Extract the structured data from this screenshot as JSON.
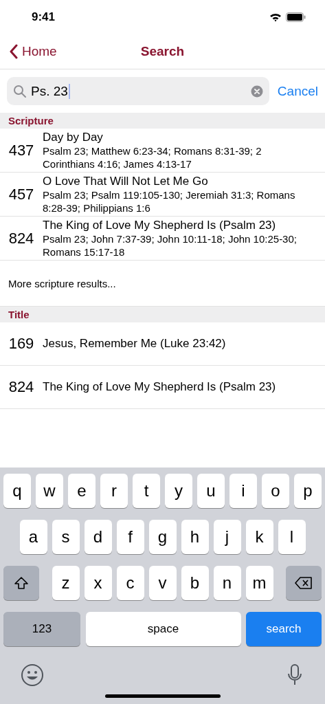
{
  "status_bar": {
    "time": "9:41"
  },
  "nav": {
    "back": "Home",
    "title": "Search"
  },
  "search": {
    "value": "Ps. 23",
    "cancel": "Cancel"
  },
  "sections": [
    {
      "title": "Scripture",
      "rows": [
        {
          "number": "437",
          "title": "Day by Day",
          "refs": "Psalm 23; Matthew 6:23-34; Romans 8:31-39; 2 Corinthians 4:16; James 4:13-17"
        },
        {
          "number": "457",
          "title": "O Love That Will Not Let Me Go",
          "refs": "Psalm 23; Psalm 119:105-130; Jeremiah 31:3; Romans 8:28-39; Philippians 1:6"
        },
        {
          "number": "824",
          "title": "The King of Love My Shepherd Is (Psalm 23)",
          "refs": "Psalm 23; John 7:37-39; John 10:11-18; John 10:25-30; Romans 15:17-18"
        }
      ],
      "more": "More scripture results..."
    },
    {
      "title": "Title",
      "rows": [
        {
          "number": "169",
          "title": "Jesus, Remember Me (Luke 23:42)"
        },
        {
          "number": "824",
          "title": "The King of Love My Shepherd Is (Psalm 23)"
        }
      ]
    }
  ],
  "keyboard": {
    "rows": [
      [
        {
          "kind": "letter",
          "label": "q"
        },
        {
          "kind": "letter",
          "label": "w"
        },
        {
          "kind": "letter",
          "label": "e"
        },
        {
          "kind": "letter",
          "label": "r"
        },
        {
          "kind": "letter",
          "label": "t"
        },
        {
          "kind": "letter",
          "label": "y"
        },
        {
          "kind": "letter",
          "label": "u"
        },
        {
          "kind": "letter",
          "label": "i"
        },
        {
          "kind": "letter",
          "label": "o"
        },
        {
          "kind": "letter",
          "label": "p"
        }
      ],
      [
        {
          "kind": "letter",
          "label": "a"
        },
        {
          "kind": "letter",
          "label": "s"
        },
        {
          "kind": "letter",
          "label": "d"
        },
        {
          "kind": "letter",
          "label": "f"
        },
        {
          "kind": "letter",
          "label": "g"
        },
        {
          "kind": "letter",
          "label": "h"
        },
        {
          "kind": "letter",
          "label": "j"
        },
        {
          "kind": "letter",
          "label": "k"
        },
        {
          "kind": "letter",
          "label": "l"
        }
      ],
      [
        {
          "kind": "shift"
        },
        {
          "kind": "letter",
          "label": "z"
        },
        {
          "kind": "letter",
          "label": "x"
        },
        {
          "kind": "letter",
          "label": "c"
        },
        {
          "kind": "letter",
          "label": "v"
        },
        {
          "kind": "letter",
          "label": "b"
        },
        {
          "kind": "letter",
          "label": "n"
        },
        {
          "kind": "letter",
          "label": "m"
        },
        {
          "kind": "delete"
        }
      ]
    ],
    "bottom_bar": {
      "numbers": "123",
      "space": "space",
      "action": "search"
    }
  }
}
